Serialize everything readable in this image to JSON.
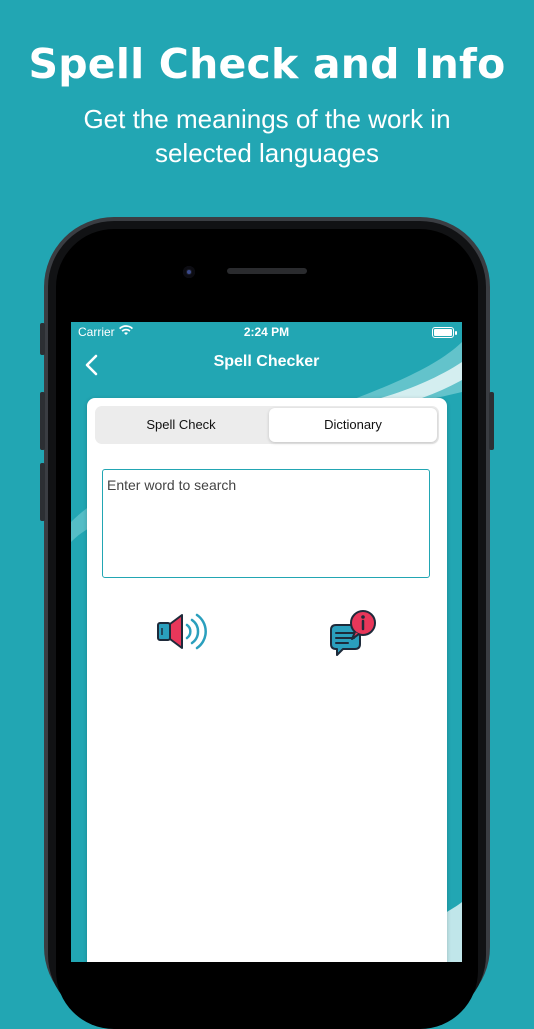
{
  "header": {
    "title": "Spell Check and Info",
    "subtitle": "Get the meanings of the work in selected languages"
  },
  "status_bar": {
    "carrier": "Carrier",
    "time": "2:24 PM"
  },
  "nav": {
    "title": "Spell Checker"
  },
  "tabs": [
    {
      "label": "Spell Check",
      "selected": false
    },
    {
      "label": "Dictionary",
      "selected": true
    }
  ],
  "search": {
    "value": "",
    "placeholder": "Enter word to search"
  },
  "actions": {
    "speak_icon": "speaker-icon",
    "info_icon": "chat-info-icon"
  },
  "colors": {
    "background": "#22a6b3",
    "accent": "#22a6b3",
    "icon_red": "#e8375a",
    "icon_blue": "#2a9fbd",
    "icon_dark": "#1e2a3a"
  }
}
